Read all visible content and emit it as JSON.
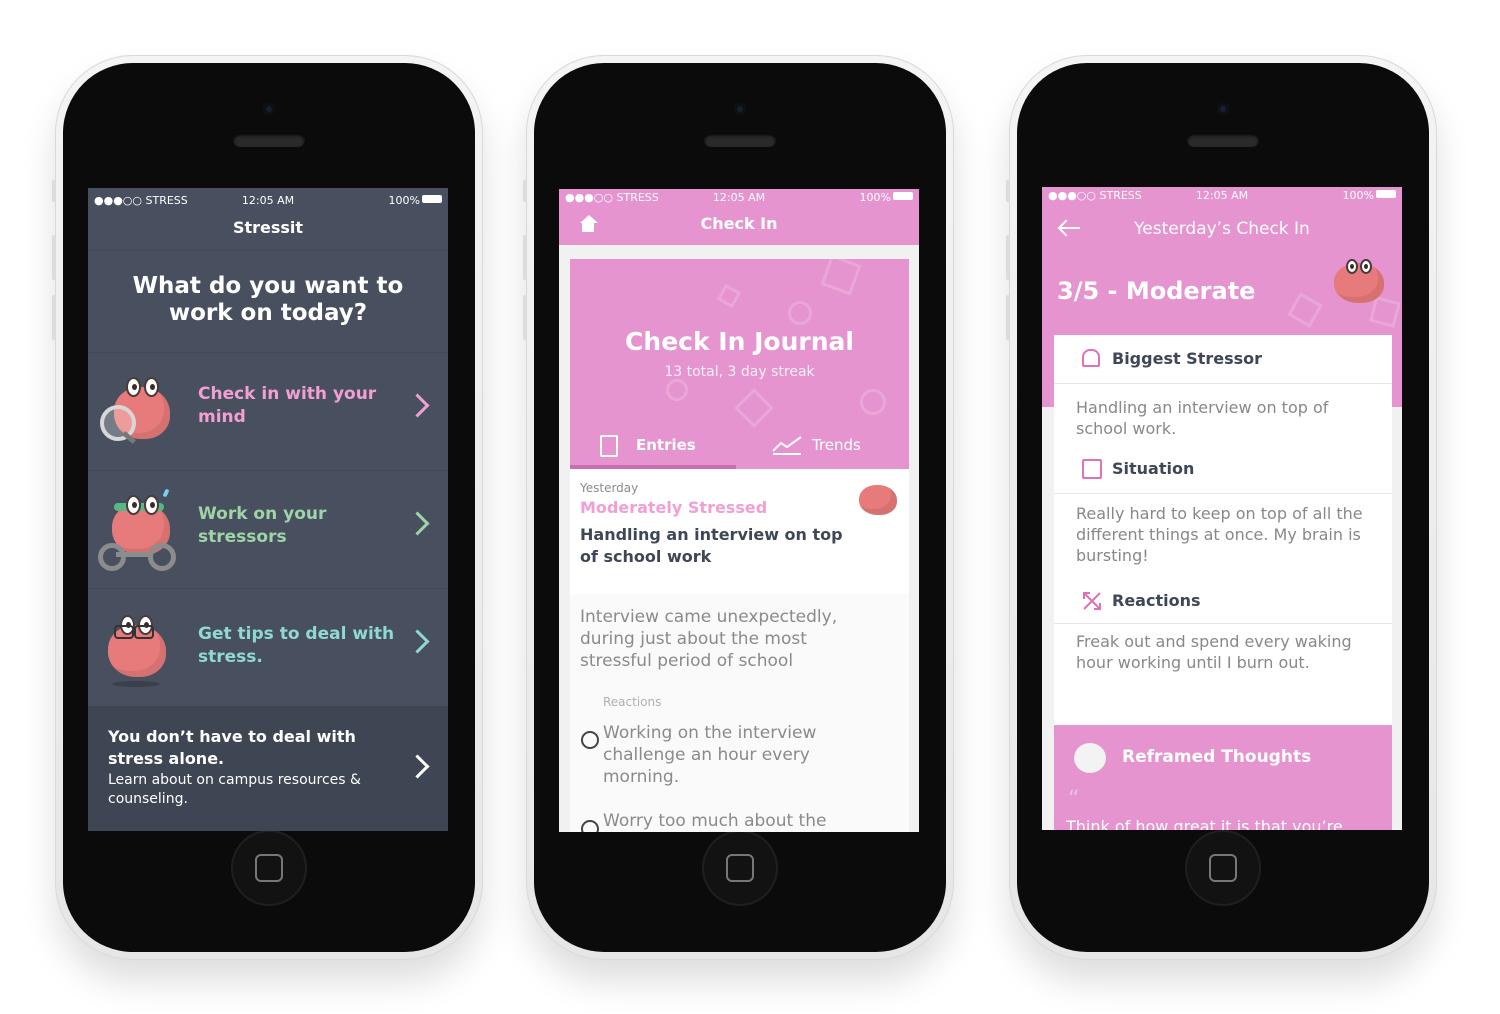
{
  "colors": {
    "dark_bg": "#48505f",
    "pink": "#e594cf",
    "pink_text": "#f19fd4",
    "green_text": "#9ed4a6",
    "teal_text": "#8fd8d4",
    "slate_text": "#3f4756"
  },
  "screen1": {
    "status": {
      "carrier": "●●●○○ STRESS",
      "time": "12:05 AM",
      "battery": "100%"
    },
    "title": "Stressit",
    "question": "What do you want to work on today?",
    "items": [
      {
        "label": "Check in with your mind",
        "icon": "brain-magnifier-icon",
        "color": "#f19fd4"
      },
      {
        "label": "Work on your stressors",
        "icon": "brain-workout-icon",
        "color": "#9ed4a6"
      },
      {
        "label": "Get tips to deal with stress.",
        "icon": "brain-glasses-icon",
        "color": "#8fd8d4"
      }
    ],
    "footer": {
      "title": "You don’t have to deal with stress alone.",
      "subtitle": "Learn about on campus resources & counseling."
    }
  },
  "screen2": {
    "status": {
      "carrier": "●●●○○ STRESS",
      "time": "12:05 AM",
      "battery": "100%"
    },
    "nav_title": "Check In",
    "hero": {
      "title": "Check In Journal",
      "subtitle": "13 total, 3 day streak"
    },
    "tabs": {
      "entries": "Entries",
      "trends": "Trends"
    },
    "entry": {
      "date": "Yesterday",
      "level": "Moderately Stressed",
      "headline": "Handling an interview on top of school work",
      "situation": "Interview came unexpectedly, during just about the most stressful period of school",
      "reactions_label": "Reactions",
      "reaction1": "Working on the interview challenge an hour every morning.",
      "reaction2": "Worry too much about the"
    }
  },
  "screen3": {
    "status": {
      "carrier": "●●●○○ STRESS",
      "time": "12:05 AM",
      "battery": "100%"
    },
    "nav_title": "Yesterday’s Check In",
    "rating": "3/5 - Moderate",
    "stressor_label": "Biggest Stressor",
    "stressor_text": "Handling an interview on top of school work.",
    "situation_label": "Situation",
    "situation_text": "Really hard to keep on top of all the different things at once. My brain is bursting!",
    "reactions_label": "Reactions",
    "reactions_text": "Freak out and spend every waking hour working until I burn out.",
    "reframed_label": "Reframed Thoughts",
    "quote_mark": "“",
    "reframed_text": "Think of how great it is that you’re"
  }
}
